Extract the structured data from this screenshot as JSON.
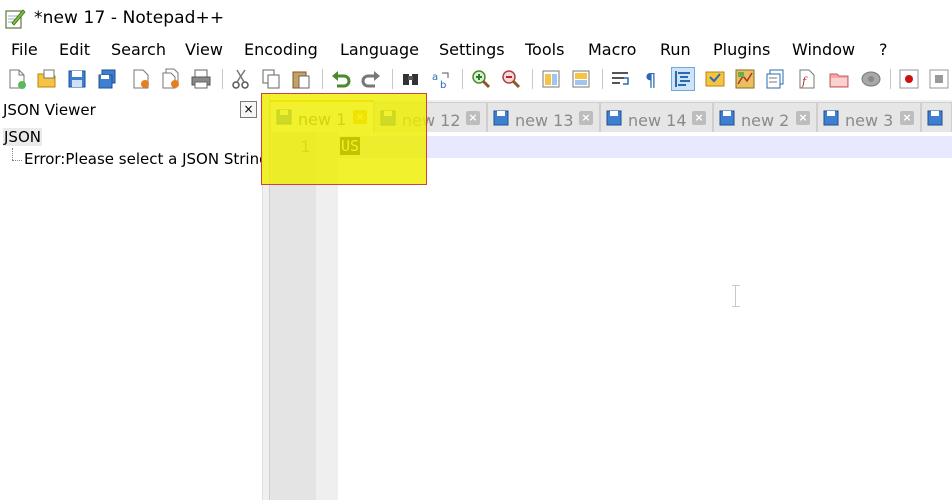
{
  "window": {
    "title": "*new 17 - Notepad++",
    "icon": "notepad-plus-plus-icon"
  },
  "menu": [
    "File",
    "Edit",
    "Search",
    "View",
    "Encoding",
    "Language",
    "Settings",
    "Tools",
    "Macro",
    "Run",
    "Plugins",
    "Window",
    "?"
  ],
  "toolbar": {
    "icons": [
      "new-file-icon",
      "open-file-icon",
      "save-icon",
      "save-all-icon",
      "close-icon",
      "close-all-icon",
      "print-icon",
      "cut-icon",
      "copy-icon",
      "paste-icon",
      "undo-icon",
      "redo-icon",
      "find-icon",
      "replace-icon",
      "zoom-in-icon",
      "zoom-out-icon",
      "sync-vertical-icon",
      "sync-horizontal-icon",
      "word-wrap-icon",
      "show-all-chars-icon",
      "indent-guide-icon",
      "user-language-icon",
      "document-map-icon",
      "document-list-icon",
      "function-list-icon",
      "folder-workspace-icon",
      "monitoring-icon",
      "record-macro-icon",
      "stop-record-icon"
    ]
  },
  "panel": {
    "title": "JSON Viewer",
    "close_label": "×",
    "tree_root": "JSON",
    "tree_child": "Error:Please select a JSON String."
  },
  "tabs": [
    {
      "label": "new 1",
      "active": true
    },
    {
      "label": "new 12",
      "active": false
    },
    {
      "label": "new 13",
      "active": false
    },
    {
      "label": "new 14",
      "active": false
    },
    {
      "label": "new 2",
      "active": false
    },
    {
      "label": "new 3",
      "active": false
    }
  ],
  "tab_close_label": "×",
  "editor": {
    "line_number": "1",
    "text": "US"
  },
  "colors": {
    "highlight": "#eeee00",
    "highlight_border": "#d04040",
    "active_tab_close": "#f6b000",
    "current_line": "#e8e8ff"
  }
}
